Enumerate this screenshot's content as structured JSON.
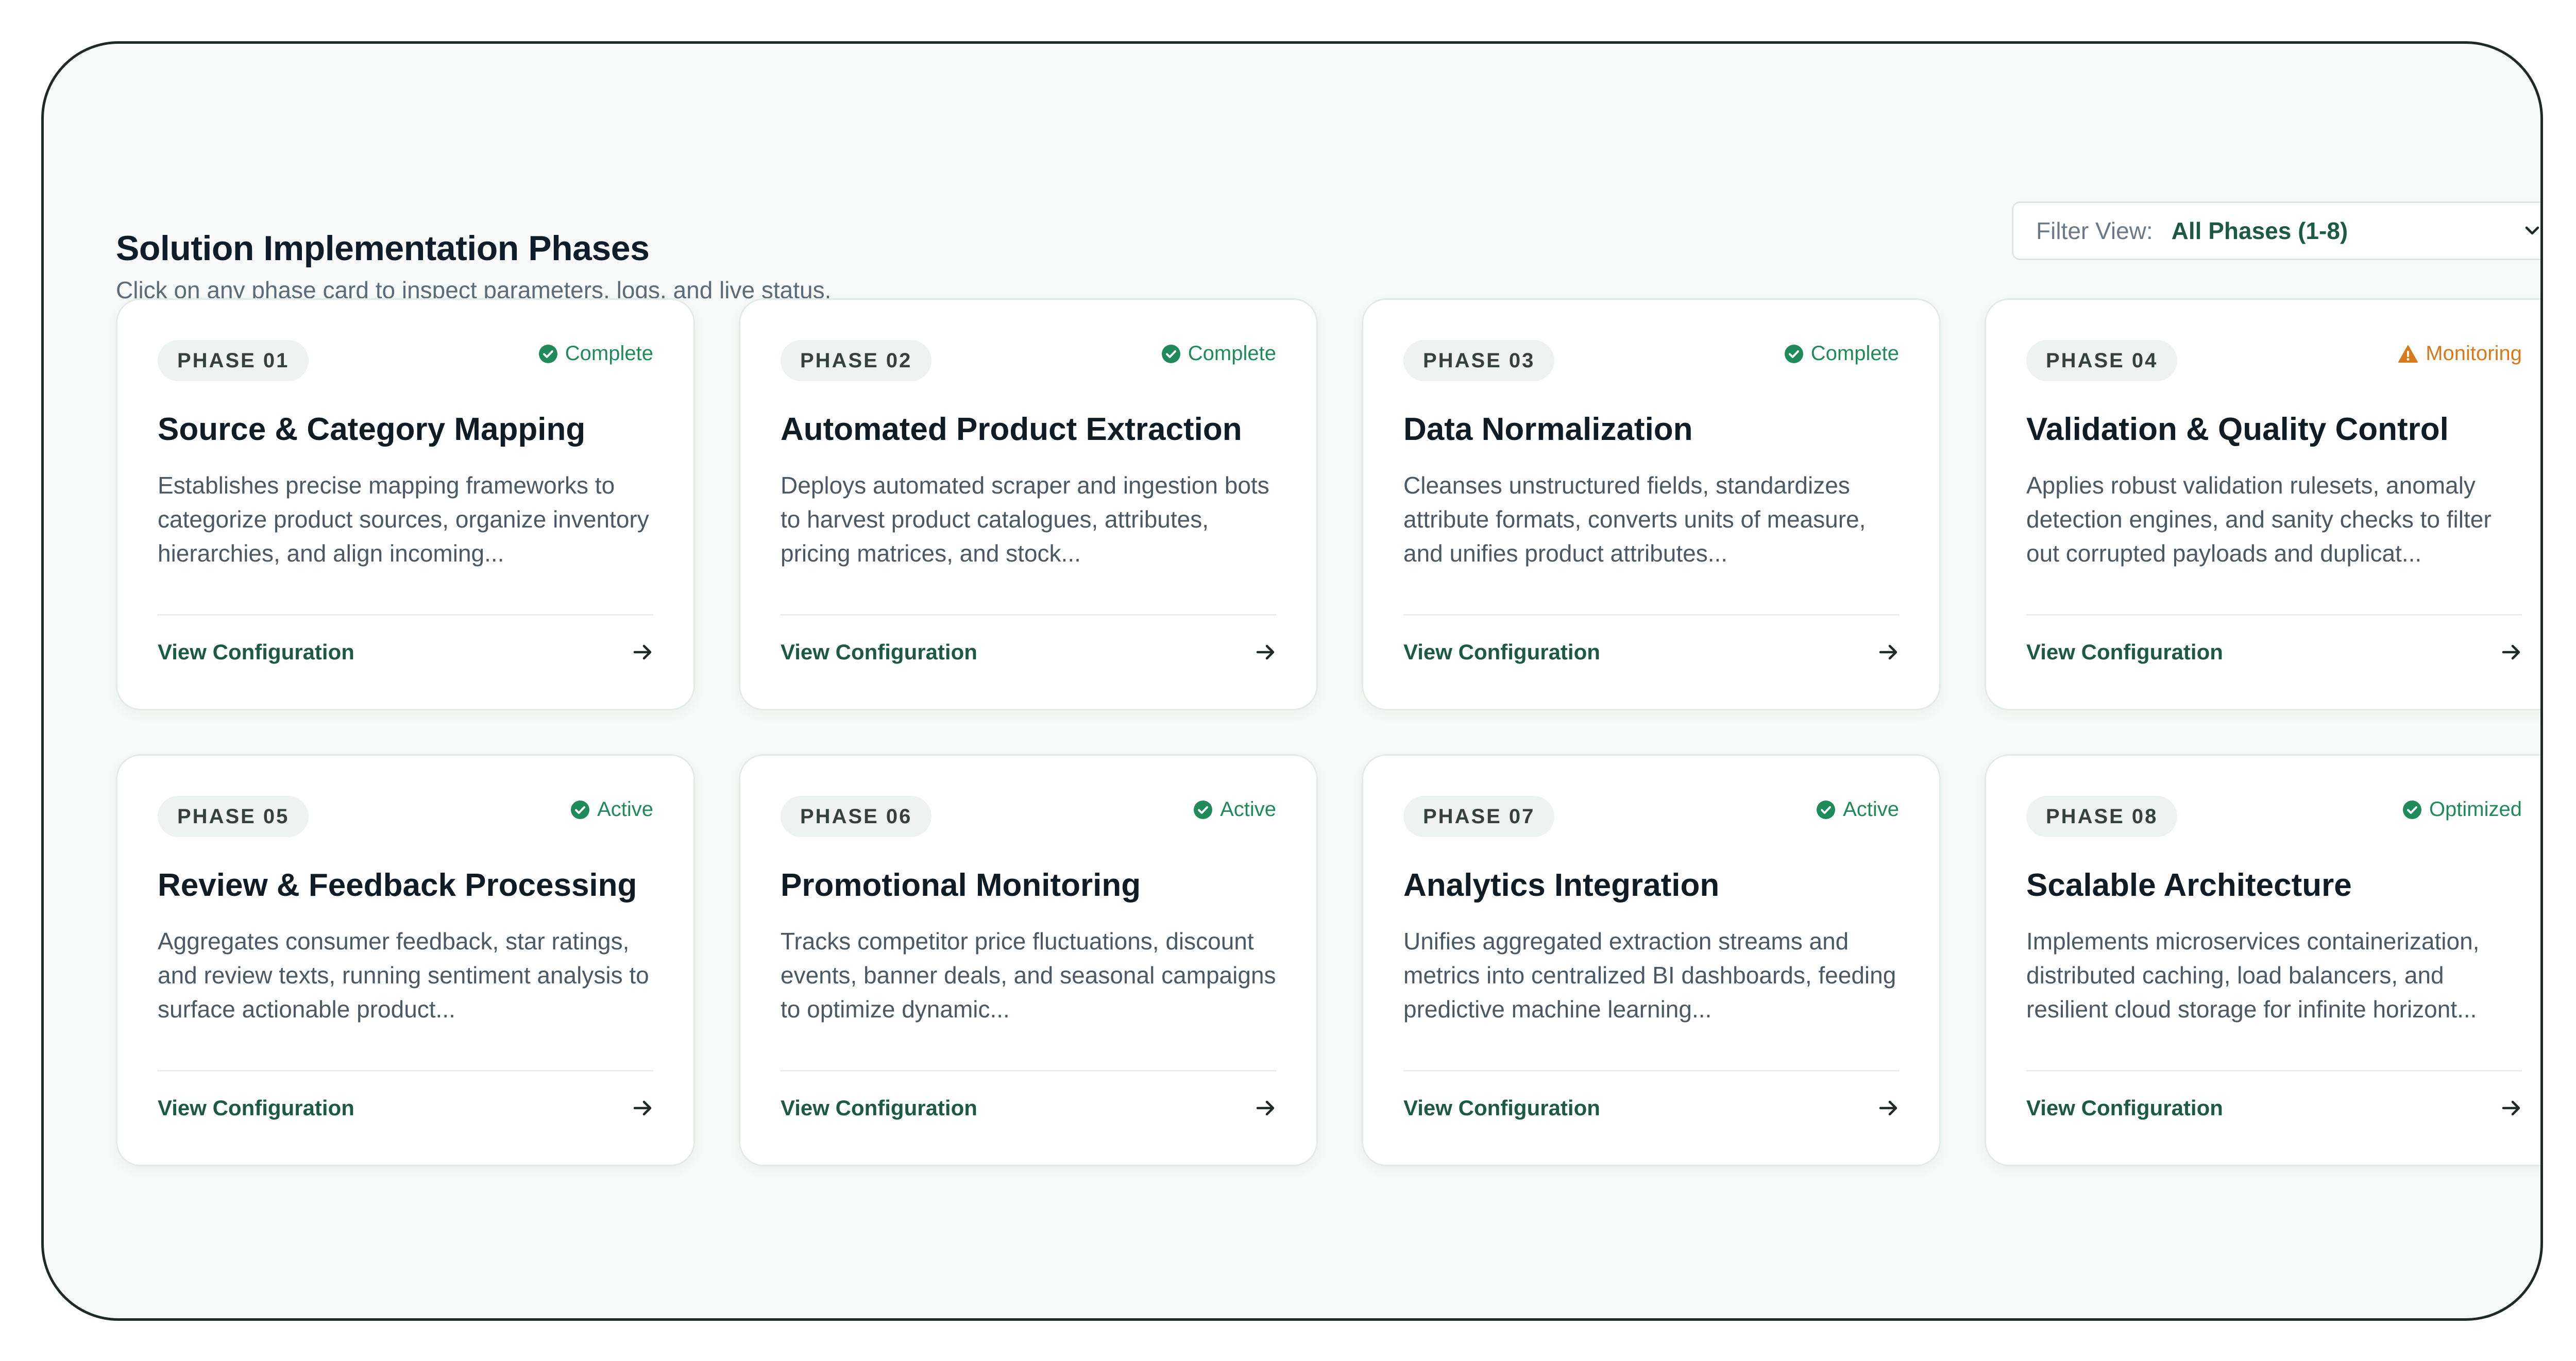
{
  "header": {
    "title": "Solution Implementation Phases",
    "subtitle": "Click on any phase card to inspect parameters, logs, and live status."
  },
  "filter": {
    "label": "Filter View:",
    "value": "All Phases (1-8)"
  },
  "colors": {
    "accent": "#1d5a45",
    "status_ok": "#1f8a5a",
    "status_warn": "#d9791b",
    "badge_bg": "#eef2f0"
  },
  "phases": [
    {
      "badge": "PHASE 01",
      "status": "Complete",
      "status_icon": "check-circle-icon",
      "title": "Source & Category Mapping",
      "description": "Establishes precise mapping frameworks to categorize product sources, organize inventory hierarchies, and align incoming...",
      "link": "View Configuration"
    },
    {
      "badge": "PHASE 02",
      "status": "Complete",
      "status_icon": "check-circle-icon",
      "title": "Automated Product Extraction",
      "description": "Deploys automated scraper and ingestion bots to harvest product catalogues, attributes, pricing matrices, and stock...",
      "link": "View Configuration"
    },
    {
      "badge": "PHASE 03",
      "status": "Complete",
      "status_icon": "check-circle-icon",
      "title": "Data Normalization",
      "description": "Cleanses unstructured fields, standardizes attribute formats, converts units of measure, and unifies product attributes...",
      "link": "View Configuration"
    },
    {
      "badge": "PHASE 04",
      "status": "Monitoring",
      "status_icon": "warning-triangle-icon",
      "title": "Validation & Quality Control",
      "description": "Applies robust validation rulesets, anomaly detection engines, and sanity checks to filter out corrupted payloads and duplicat...",
      "link": "View Configuration"
    },
    {
      "badge": "PHASE 05",
      "status": "Active",
      "status_icon": "check-circle-icon",
      "title": "Review & Feedback Processing",
      "description": "Aggregates consumer feedback, star ratings, and review texts, running sentiment analysis to surface actionable product...",
      "link": "View Configuration"
    },
    {
      "badge": "PHASE 06",
      "status": "Active",
      "status_icon": "check-circle-icon",
      "title": "Promotional Monitoring",
      "description": "Tracks competitor price fluctuations, discount events, banner deals, and seasonal campaigns to optimize dynamic...",
      "link": "View Configuration"
    },
    {
      "badge": "PHASE 07",
      "status": "Active",
      "status_icon": "check-circle-icon",
      "title": "Analytics Integration",
      "description": "Unifies aggregated extraction streams and metrics into centralized BI dashboards, feeding predictive machine learning...",
      "link": "View Configuration"
    },
    {
      "badge": "PHASE 08",
      "status": "Optimized",
      "status_icon": "check-circle-icon",
      "title": "Scalable Architecture",
      "description": "Implements microservices containerization, distributed caching, load balancers, and resilient cloud storage for infinite horizont...",
      "link": "View Configuration"
    }
  ]
}
